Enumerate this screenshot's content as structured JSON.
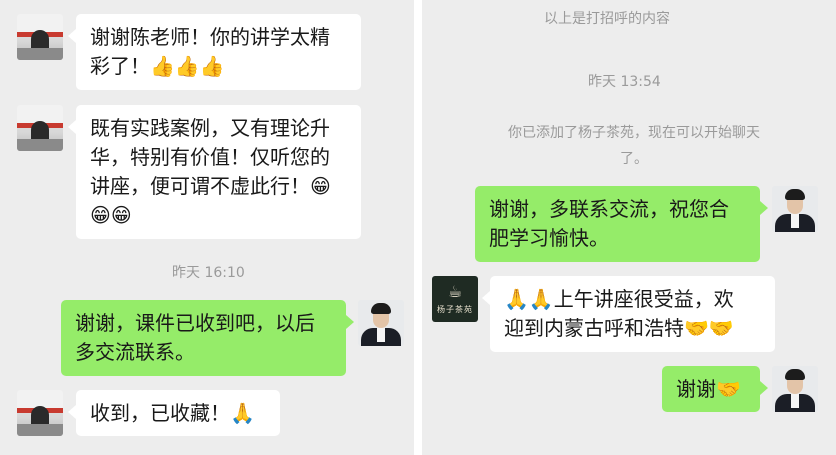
{
  "left_panel": {
    "messages": [
      {
        "lines": [
          "谢谢陈老师！你的讲学太精",
          "彩了！👍👍👍"
        ]
      },
      {
        "lines": [
          "既有实践案例，又有理论升",
          "华，特别有价值！仅听您的",
          "讲座，便可谓不虚此行！😁",
          "😁😁"
        ]
      },
      {
        "lines": [
          "谢谢，课件已收到吧，以后",
          "多交流联系。"
        ]
      },
      {
        "lines": [
          "收到，已收藏！🙏"
        ]
      }
    ],
    "timestamp": "昨天 16:10"
  },
  "right_panel": {
    "system_top": "以上是打招呼的内容",
    "timestamp": "昨天 13:54",
    "system_added": [
      "你已添加了杨子茶苑，现在可以开始聊天",
      "了。"
    ],
    "contact_logo_text": "杨子茶苑",
    "messages": [
      {
        "lines": [
          "谢谢，多联系交流，祝您合",
          "肥学习愉快。"
        ]
      },
      {
        "lines": [
          "🙏🙏上午讲座很受益，欢",
          "迎到内蒙古呼和浩特🤝🤝"
        ]
      },
      {
        "lines": [
          "谢谢🤝"
        ]
      }
    ]
  }
}
